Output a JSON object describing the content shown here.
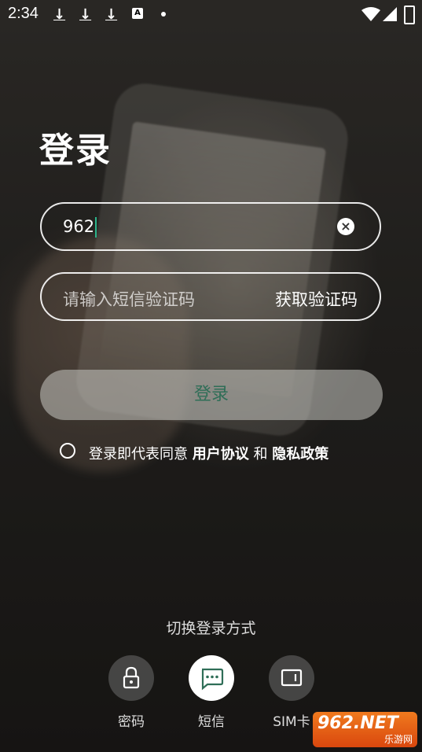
{
  "status_bar": {
    "time": "2:34",
    "icons": [
      "download-icon",
      "download-icon",
      "download-icon",
      "a-icon",
      "dot-icon",
      "wifi-icon",
      "signal-icon",
      "battery-icon"
    ]
  },
  "title": "登录",
  "phone_field": {
    "value": "962"
  },
  "code_field": {
    "placeholder": "请输入短信验证码",
    "action_label": "获取验证码"
  },
  "login_button": {
    "label": "登录"
  },
  "agreement": {
    "prefix": "登录即代表同意",
    "user_agreement": "用户协议",
    "and": "和",
    "privacy_policy": "隐私政策"
  },
  "switch_login": {
    "title": "切换登录方式",
    "methods": [
      {
        "label": "密码",
        "icon": "lock-icon"
      },
      {
        "label": "短信",
        "icon": "message-icon"
      },
      {
        "label": "SIM卡",
        "icon": "sim-card-icon"
      }
    ]
  },
  "watermark": {
    "top": "962.NET",
    "bottom": "乐游网"
  }
}
